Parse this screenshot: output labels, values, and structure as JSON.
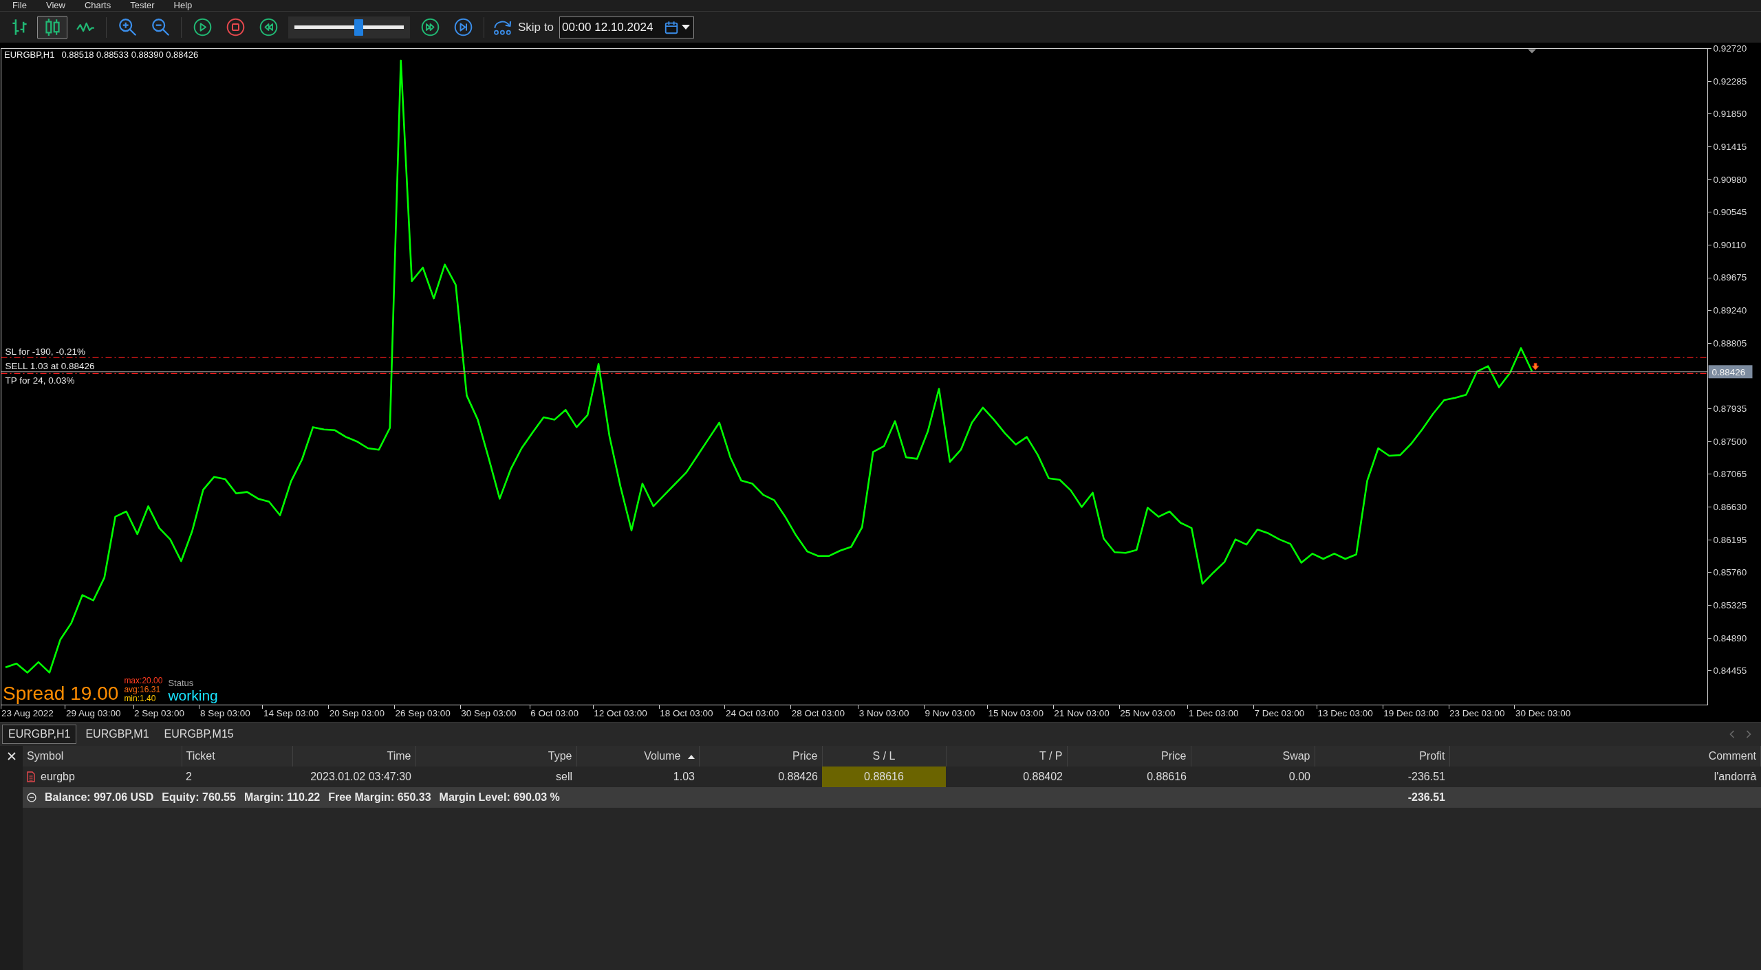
{
  "menu": [
    "File",
    "View",
    "Charts",
    "Tester",
    "Help"
  ],
  "toolbar": {
    "chart_types": [
      {
        "kind": "bars",
        "selected": false
      },
      {
        "kind": "candlesticks",
        "selected": true
      },
      {
        "kind": "line",
        "selected": false
      }
    ],
    "zoom": [
      {
        "kind": "zoom_in"
      },
      {
        "kind": "zoom_out"
      }
    ],
    "playback": [
      {
        "kind": "play"
      },
      {
        "kind": "stop"
      },
      {
        "kind": "rewind"
      }
    ],
    "speed": {
      "level": 0.59
    },
    "stepping": [
      {
        "kind": "fast_forward"
      },
      {
        "kind": "step_to_end"
      }
    ],
    "skip_to": {
      "label": "Skip to",
      "value": "00:00 12.10.2024"
    }
  },
  "chart": {
    "symbol": "EURGBP,H1",
    "quote": "0.88518 0.88533 0.88390 0.88426",
    "price_tag": "0.88426",
    "chart_data": {
      "type": "line",
      "ylim": [
        0.84,
        0.9272
      ],
      "categories": [
        null,
        null,
        "23 Aug 2022",
        null,
        null,
        null,
        null,
        null,
        "29 Aug 03:00",
        null,
        null,
        null,
        null,
        null,
        "2 Sep 03:00",
        null,
        null,
        null,
        null,
        null,
        "8 Sep 03:00",
        null,
        null,
        null,
        null,
        null,
        "14 Sep 03:00",
        null,
        null,
        null,
        null,
        null,
        "20 Sep 03:00",
        null,
        null,
        null,
        null,
        null,
        "26 Sep 03:00",
        null,
        null,
        null,
        null,
        null,
        "30 Sep 03:00",
        null,
        null,
        null,
        null,
        null,
        "6 Oct 03:00",
        null,
        null,
        null,
        null,
        null,
        "12 Oct 03:00",
        null,
        null,
        null,
        null,
        null,
        "18 Oct 03:00",
        null,
        null,
        null,
        null,
        null,
        "24 Oct 03:00",
        null,
        null,
        null,
        null,
        null,
        "28 Oct 03:00",
        null,
        null,
        null,
        null,
        null,
        "3 Nov 03:00",
        null,
        null,
        null,
        null,
        null,
        "9 Nov 03:00",
        null,
        null,
        null,
        null,
        null,
        "15 Nov 03:00",
        null,
        null,
        null,
        null,
        null,
        "21 Nov 03:00",
        null,
        null,
        null,
        null,
        null,
        "25 Nov 03:00",
        null,
        null,
        null,
        null,
        null,
        "1 Dec 03:00",
        null,
        null,
        null,
        null,
        null,
        "7 Dec 03:00",
        null,
        null,
        null,
        null,
        null,
        "13 Dec 03:00",
        null,
        null,
        null,
        null,
        null,
        "19 Dec 03:00",
        null,
        null,
        null,
        null,
        null,
        "23 Dec 03:00",
        null,
        null,
        null,
        null,
        null,
        "30 Dec 03:00",
        null,
        null,
        null,
        null,
        null,
        null,
        null,
        null,
        null,
        null,
        null,
        null,
        null,
        null,
        null
      ],
      "yticks": [
        {
          "value": 0.9272,
          "label": "0.92720"
        },
        {
          "value": 0.92285,
          "label": "0.92285"
        },
        {
          "value": 0.9185,
          "label": "0.91850"
        },
        {
          "value": 0.91415,
          "label": "0.91415"
        },
        {
          "value": 0.9098,
          "label": "0.90980"
        },
        {
          "value": 0.90545,
          "label": "0.90545"
        },
        {
          "value": 0.9011,
          "label": "0.90110"
        },
        {
          "value": 0.89675,
          "label": "0.89675"
        },
        {
          "value": 0.8924,
          "label": "0.89240"
        },
        {
          "value": 0.88805,
          "label": "0.88805"
        },
        {
          "value": 0.87935,
          "label": "0.87935"
        },
        {
          "value": 0.875,
          "label": "0.87500"
        },
        {
          "value": 0.87065,
          "label": "0.87065"
        },
        {
          "value": 0.8663,
          "label": "0.86630"
        },
        {
          "value": 0.86195,
          "label": "0.86195"
        },
        {
          "value": 0.8576,
          "label": "0.85760"
        },
        {
          "value": 0.85325,
          "label": "0.85325"
        },
        {
          "value": 0.8489,
          "label": "0.84890"
        },
        {
          "value": 0.84455,
          "label": "0.84455"
        }
      ],
      "series": [
        {
          "color": "#00ff00",
          "values": [
            0.845,
            0.8455,
            0.8443,
            0.8457,
            0.8443,
            0.8487,
            0.8509,
            0.8546,
            0.8539,
            0.8569,
            0.865,
            0.8657,
            0.8627,
            0.8664,
            0.8635,
            0.862,
            0.8591,
            0.8631,
            0.8686,
            0.8703,
            0.87,
            0.8681,
            0.8683,
            0.8674,
            0.867,
            0.8652,
            0.8697,
            0.8726,
            0.8769,
            0.8766,
            0.8765,
            0.8756,
            0.875,
            0.8741,
            0.8739,
            0.8768,
            0.9256,
            0.8963,
            0.8981,
            0.894,
            0.8985,
            0.8958,
            0.8811,
            0.8779,
            0.8728,
            0.8674,
            0.8713,
            0.8741,
            0.8762,
            0.8782,
            0.8779,
            0.8792,
            0.8769,
            0.8785,
            0.8853,
            0.8757,
            0.869,
            0.8632,
            0.8694,
            0.8664,
            0.8679,
            0.8694,
            0.8709,
            0.8731,
            0.8753,
            0.8775,
            0.8729,
            0.8698,
            0.8694,
            0.8679,
            0.8672,
            0.865,
            0.8625,
            0.8604,
            0.8598,
            0.8598,
            0.8605,
            0.861,
            0.8636,
            0.8736,
            0.8744,
            0.8777,
            0.8729,
            0.8727,
            0.8764,
            0.882,
            0.8723,
            0.8739,
            0.8775,
            0.8795,
            0.8779,
            0.8761,
            0.8746,
            0.8756,
            0.8732,
            0.8701,
            0.8699,
            0.8685,
            0.8663,
            0.8682,
            0.8621,
            0.8603,
            0.8602,
            0.8606,
            0.8662,
            0.865,
            0.8657,
            0.8642,
            0.8635,
            0.8561,
            0.8576,
            0.859,
            0.862,
            0.8613,
            0.8633,
            0.8628,
            0.862,
            0.8614,
            0.8589,
            0.8601,
            0.8594,
            0.8601,
            0.8594,
            0.86,
            0.8698,
            0.8741,
            0.8731,
            0.8732,
            0.8747,
            0.8766,
            0.8787,
            0.8805,
            0.8808,
            0.8812,
            0.8843,
            0.885,
            0.8822,
            0.8841,
            0.8874,
            0.8843,
            null,
            null,
            null,
            null,
            null,
            null,
            null,
            null,
            null,
            null,
            null,
            null,
            null,
            null,
            null,
            null
          ]
        }
      ],
      "ref_lines": [
        {
          "axis": "y",
          "value": 0.88616,
          "label": "SL for -190, -0.21%",
          "color": "#ff1e1e"
        },
        {
          "axis": "y",
          "value": 0.88426,
          "label": "SELL 1.03 at 0.88426",
          "color": "#a6a6a6"
        },
        {
          "axis": "y",
          "value": 0.88402,
          "label": "TP for 24, 0.03%",
          "color": "#ff1e1e"
        }
      ]
    },
    "spread_panel": {
      "label": "Spread",
      "value": "19.00",
      "stats": [
        {
          "text": "max:20.00",
          "color": "#ff3b1f"
        },
        {
          "text": "avg:16.31",
          "color": "#ff6a10"
        },
        {
          "text": "min:1.40",
          "color": "#ffc800"
        }
      ],
      "status_label": "Status",
      "status": "working"
    }
  },
  "chart_tabs": [
    {
      "label": "EURGBP,H1",
      "selected": true
    },
    {
      "label": "EURGBP,M1",
      "selected": false
    },
    {
      "label": "EURGBP,M15",
      "selected": false
    }
  ],
  "positions": {
    "columns": [
      {
        "label": "Symbol",
        "sorted": false
      },
      {
        "label": "Ticket",
        "sorted": false
      },
      {
        "label": "Time",
        "sorted": false
      },
      {
        "label": "Type",
        "sorted": false
      },
      {
        "label": "Volume",
        "sorted": true
      },
      {
        "label": "Price",
        "sorted": false
      },
      {
        "label": "S / L",
        "sorted": false
      },
      {
        "label": "T / P",
        "sorted": false
      },
      {
        "label": "Price",
        "sorted": false
      },
      {
        "label": "Swap",
        "sorted": false
      },
      {
        "label": "Profit",
        "sorted": false
      },
      {
        "label": "Comment",
        "sorted": false
      }
    ],
    "rows": [
      {
        "cells": [
          {
            "text": "eurgbp",
            "highlighted": false
          },
          {
            "text": "2",
            "highlighted": false
          },
          {
            "text": "2023.01.02 03:47:30",
            "highlighted": false
          },
          {
            "text": "sell",
            "highlighted": false
          },
          {
            "text": "1.03",
            "highlighted": false
          },
          {
            "text": "0.88426",
            "highlighted": false
          },
          {
            "text": "0.88616",
            "highlighted": true
          },
          {
            "text": "0.88402",
            "highlighted": false
          },
          {
            "text": "0.88616",
            "highlighted": false
          },
          {
            "text": "0.00",
            "highlighted": false
          },
          {
            "text": "-236.51",
            "highlighted": false
          },
          {
            "text": "l'andorrà",
            "highlighted": false
          }
        ]
      }
    ],
    "summary": {
      "items": [
        "Balance: 997.06 USD",
        "Equity: 760.55",
        "Margin: 110.22",
        "Free Margin: 650.33",
        "Margin Level: 690.03 %"
      ],
      "profit": "-236.51"
    }
  }
}
